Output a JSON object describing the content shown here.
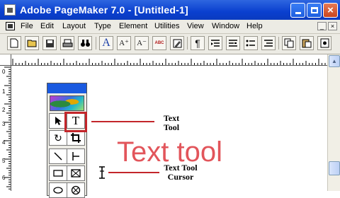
{
  "window": {
    "title": "Adobe PageMaker 7.0 - [Untitled-1]",
    "controls": {
      "minimize": "minimize",
      "maximize": "maximize",
      "close": "×"
    }
  },
  "menubar": {
    "items": [
      {
        "label": "File"
      },
      {
        "label": "Edit"
      },
      {
        "label": "Layout"
      },
      {
        "label": "Type"
      },
      {
        "label": "Element"
      },
      {
        "label": "Utilities"
      },
      {
        "label": "View"
      },
      {
        "label": "Window"
      },
      {
        "label": "Help"
      }
    ],
    "doc_controls": [
      "_",
      "×"
    ]
  },
  "toolbar": {
    "buttons": [
      {
        "icon": "new-document-icon"
      },
      {
        "icon": "open-folder-icon"
      },
      {
        "icon": "save-icon"
      },
      {
        "icon": "print-icon"
      },
      {
        "icon": "find-binoculars-icon"
      },
      {
        "icon": "character-spec-icon",
        "glyph": "A"
      },
      {
        "icon": "font-size-up-icon",
        "glyph": "A⁺"
      },
      {
        "icon": "font-size-down-icon",
        "glyph": "A⁻"
      },
      {
        "icon": "spell-check-icon",
        "glyph": "ABC"
      },
      {
        "icon": "edit-story-icon"
      },
      {
        "icon": "paragraph-icon",
        "glyph": "¶"
      },
      {
        "icon": "indents-tabs-icon"
      },
      {
        "icon": "hyphenation-icon"
      },
      {
        "icon": "bullets-icon"
      },
      {
        "icon": "numbering-icon"
      },
      {
        "icon": "copy-icon"
      },
      {
        "icon": "paste-icon"
      },
      {
        "icon": "styles-icon"
      }
    ]
  },
  "rulers": {
    "left_numbers": [
      "0",
      "1",
      "2",
      "3",
      "4",
      "5",
      "6"
    ]
  },
  "toolbox": {
    "tools": [
      {
        "name": "pointer-tool",
        "glyph": "↖"
      },
      {
        "name": "text-tool",
        "glyph": "T",
        "selected": true
      },
      {
        "name": "rotate-tool",
        "glyph": "↻"
      },
      {
        "name": "crop-tool",
        "glyph": "⌗"
      },
      {
        "name": "line-tool",
        "glyph": "╲"
      },
      {
        "name": "constrained-line-tool",
        "glyph": "⊢"
      },
      {
        "name": "rectangle-tool",
        "glyph": "▭"
      },
      {
        "name": "rectangle-frame-tool",
        "glyph": "⊠"
      },
      {
        "name": "ellipse-tool",
        "glyph": "◯"
      },
      {
        "name": "ellipse-frame-tool",
        "glyph": "⊗"
      }
    ]
  },
  "annotations": {
    "text_tool_caption_line1": "Text",
    "text_tool_caption_line2": "Tool",
    "big_label": "Text tool",
    "cursor_caption_line1": "Text Tool",
    "cursor_caption_line2": "Cursor"
  },
  "colors": {
    "titlebar": "#0a3fcf",
    "annotation_red": "#c3262b",
    "big_label": "#e2555b"
  }
}
